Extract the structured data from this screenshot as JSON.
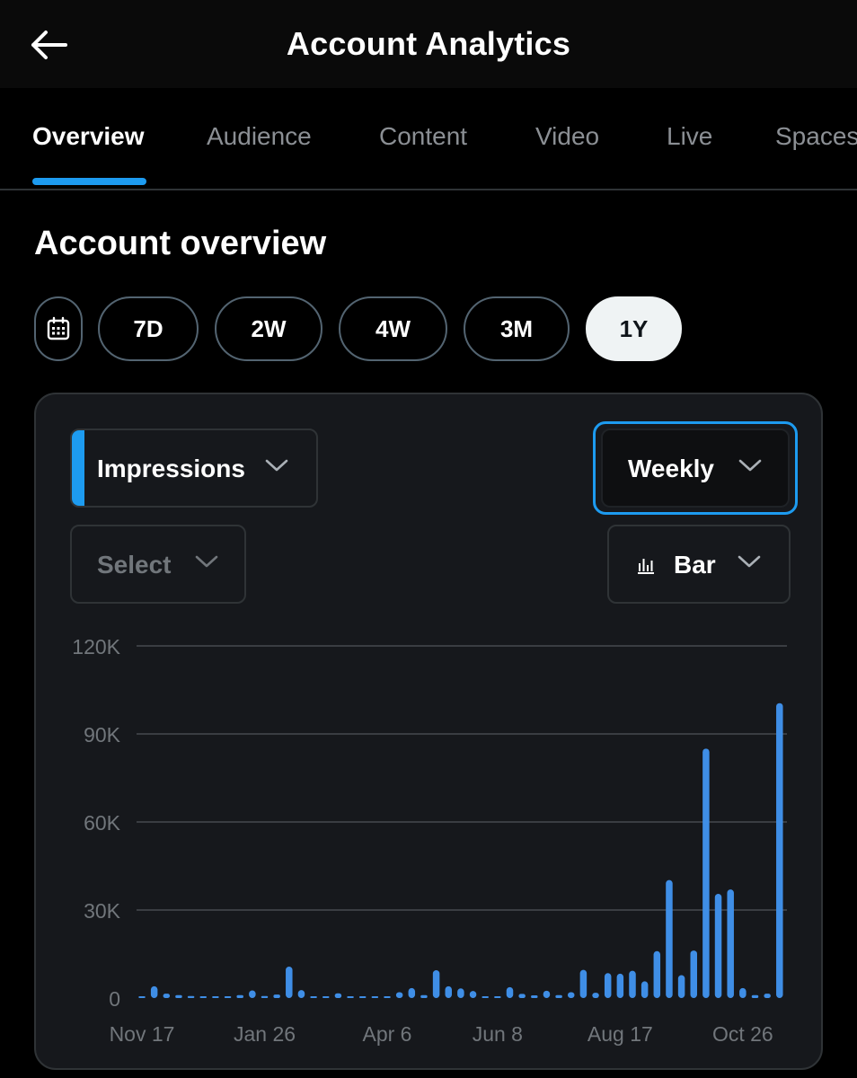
{
  "header": {
    "title": "Account Analytics",
    "back_icon": "arrow-left-icon"
  },
  "tabs": [
    {
      "label": "Overview",
      "active": true
    },
    {
      "label": "Audience",
      "active": false
    },
    {
      "label": "Content",
      "active": false
    },
    {
      "label": "Video",
      "active": false
    },
    {
      "label": "Live",
      "active": false
    },
    {
      "label": "Spaces",
      "active": false
    }
  ],
  "section": {
    "title": "Account overview"
  },
  "ranges": {
    "calendar_icon": "calendar-icon",
    "options": [
      "7D",
      "2W",
      "4W",
      "3M",
      "1Y"
    ],
    "selected": "1Y"
  },
  "controls": {
    "metric": "Impressions",
    "period": "Weekly",
    "compare_placeholder": "Select",
    "chart_type": "Bar"
  },
  "colors": {
    "accent": "#1d9bf0",
    "bar": "#3f8ee6",
    "background": "#000000",
    "card": "#16181c"
  },
  "chart_data": {
    "type": "bar",
    "xlabel": "",
    "ylabel": "",
    "ylim": [
      0,
      120000
    ],
    "y_ticks": [
      "0",
      "30K",
      "60K",
      "90K",
      "120K"
    ],
    "x_tick_labels": [
      "Nov 17",
      "Jan 26",
      "Apr 6",
      "Jun 8",
      "Aug 17",
      "Oct 26"
    ],
    "grid": true,
    "series": [
      {
        "values": [
          300,
          4000,
          1500,
          1000,
          700,
          600,
          600,
          600,
          1000,
          2600,
          700,
          1200,
          10700,
          2700,
          600,
          500,
          1600,
          500,
          500,
          500,
          500,
          2000,
          3400,
          1000,
          9500,
          4000,
          3300,
          2400,
          500,
          500,
          3700,
          1400,
          900,
          2500,
          1000,
          2000,
          9600,
          1800,
          8500,
          8300,
          9300,
          5700,
          16000,
          40200,
          7800,
          16200,
          85000,
          35500,
          37000,
          3400,
          1000,
          1500,
          100500
        ]
      }
    ]
  }
}
